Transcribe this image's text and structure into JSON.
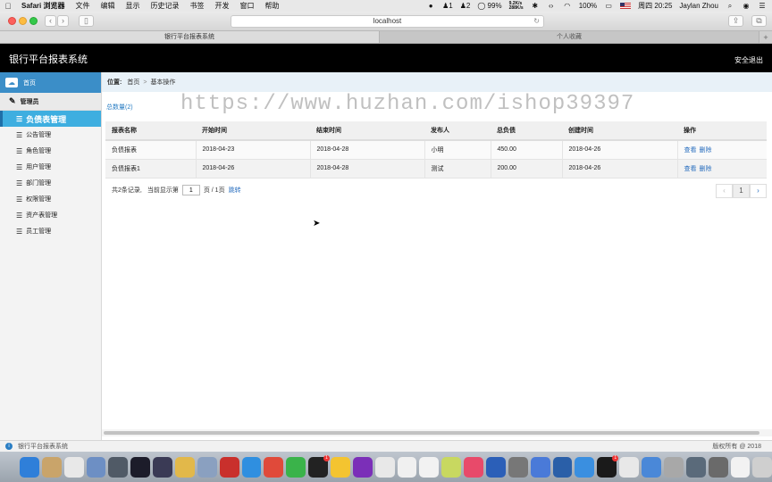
{
  "menubar": {
    "apple": "",
    "items": [
      "Safari 浏览器",
      "文件",
      "编辑",
      "显示",
      "历史记录",
      "书签",
      "开发",
      "窗口",
      "帮助"
    ],
    "battery": "99%",
    "net_up": "9.2K/s",
    "net_down": "288K/s",
    "badge_a": "1",
    "badge_b": "2",
    "battery2": "100%",
    "clock": "周四 20:25",
    "user": "Jaylan Zhou"
  },
  "browser": {
    "url": "localhost",
    "tabs": [
      "银行平台报表系统",
      "个人收藏"
    ]
  },
  "header": {
    "title": "银行平台报表系统",
    "logout": "安全退出"
  },
  "sidebar": {
    "home": "首页",
    "group": "管理员",
    "items": [
      "负债表管理",
      "公告管理",
      "角色管理",
      "用户管理",
      "部门管理",
      "权限管理",
      "资产表管理",
      "员工管理"
    ]
  },
  "breadcrumb": {
    "label": "位置:",
    "home": "首页",
    "sep": ">",
    "current": "基本操作"
  },
  "watermark": "https://www.huzhan.com/ishop39397",
  "list": {
    "total": "总数量(2)",
    "columns": [
      "报表名称",
      "开始时间",
      "结束时间",
      "发布人",
      "总负债",
      "创建时间",
      "操作"
    ],
    "rows": [
      [
        "负债报表",
        "2018-04-23",
        "2018-04-28",
        "小明",
        "450.00",
        "2018-04-26"
      ],
      [
        "负债报表1",
        "2018-04-26",
        "2018-04-28",
        "测试",
        "200.00",
        "2018-04-26"
      ]
    ],
    "action_view": "查看",
    "action_delete": "删除"
  },
  "pager": {
    "prefix": "共2条记录,",
    "current_label": "当前显示第",
    "page_value": "1",
    "suffix": "页 / 1页",
    "jump": "跳转",
    "prev": "‹",
    "page": "1",
    "next": "›"
  },
  "footer": {
    "title": "银行平台报表系统",
    "copyright": "版权所有 @ 2018"
  },
  "dock": {
    "colors": [
      "#2f7fd9",
      "#c9a46a",
      "#e8e8e8",
      "#6d8fc4",
      "#505a66",
      "#1c1c2a",
      "#3a3a55",
      "#e2b84a",
      "#8aa0c0",
      "#c9302c",
      "#2f8fe0",
      "#e04a3a",
      "#3ab34a",
      "#222",
      "#f4c430",
      "#7b2fb8",
      "#e8e8e8",
      "#f0f0f0",
      "#f2f2f2",
      "#c8d860",
      "#e84a6a",
      "#2b5fb8",
      "#777",
      "#4a7ad8",
      "#2a5fa8",
      "#3a8fe0",
      "#1a1a1a",
      "#e8e8e8",
      "#4a88d8",
      "#a8a8a8",
      "#5a6a7a",
      "#6a6a6a",
      "#f2f2f2",
      "#cfcfcf"
    ],
    "badges": {
      "wechat": "1",
      "qq": "1"
    }
  }
}
